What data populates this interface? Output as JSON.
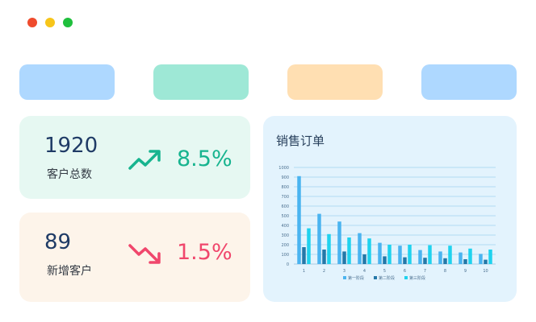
{
  "colors": {
    "window_close": "#ef4b2d",
    "window_minimize": "#f7c51a",
    "window_maximize": "#1fbf3c",
    "tab_blue": "#aed8ff",
    "tab_teal": "#9ee8d6",
    "tab_orange": "#ffdfb2",
    "up_trend": "#17b48f",
    "down_trend": "#f0466c"
  },
  "stats": {
    "customers_total": {
      "value": "1920",
      "label": "客户总数",
      "change": "8.5%",
      "trend_icon": "trend-up-icon"
    },
    "new_customers": {
      "value": "89",
      "label": "新增客户",
      "change": "1.5%",
      "trend_icon": "trend-down-icon"
    }
  },
  "chart_panel": {
    "title": "销售订单"
  },
  "chart_data": {
    "type": "bar",
    "title": "销售订单",
    "categories": [
      "1",
      "2",
      "3",
      "4",
      "5",
      "6",
      "7",
      "8",
      "9",
      "10"
    ],
    "ylim": [
      0,
      1000
    ],
    "yticks": [
      0,
      100,
      200,
      300,
      400,
      500,
      600,
      700,
      800,
      900,
      1000
    ],
    "grid": true,
    "legend_position": "bottom",
    "series": [
      {
        "name": "第一阶段",
        "color": "#4ab4f0",
        "values": [
          910,
          520,
          440,
          320,
          220,
          190,
          145,
          130,
          120,
          105
        ]
      },
      {
        "name": "第二阶段",
        "color": "#2478a8",
        "values": [
          175,
          150,
          130,
          100,
          80,
          70,
          65,
          60,
          50,
          45
        ]
      },
      {
        "name": "第三阶段",
        "color": "#1fd2ee",
        "values": [
          370,
          310,
          275,
          265,
          200,
          200,
          195,
          190,
          160,
          150
        ]
      }
    ]
  }
}
